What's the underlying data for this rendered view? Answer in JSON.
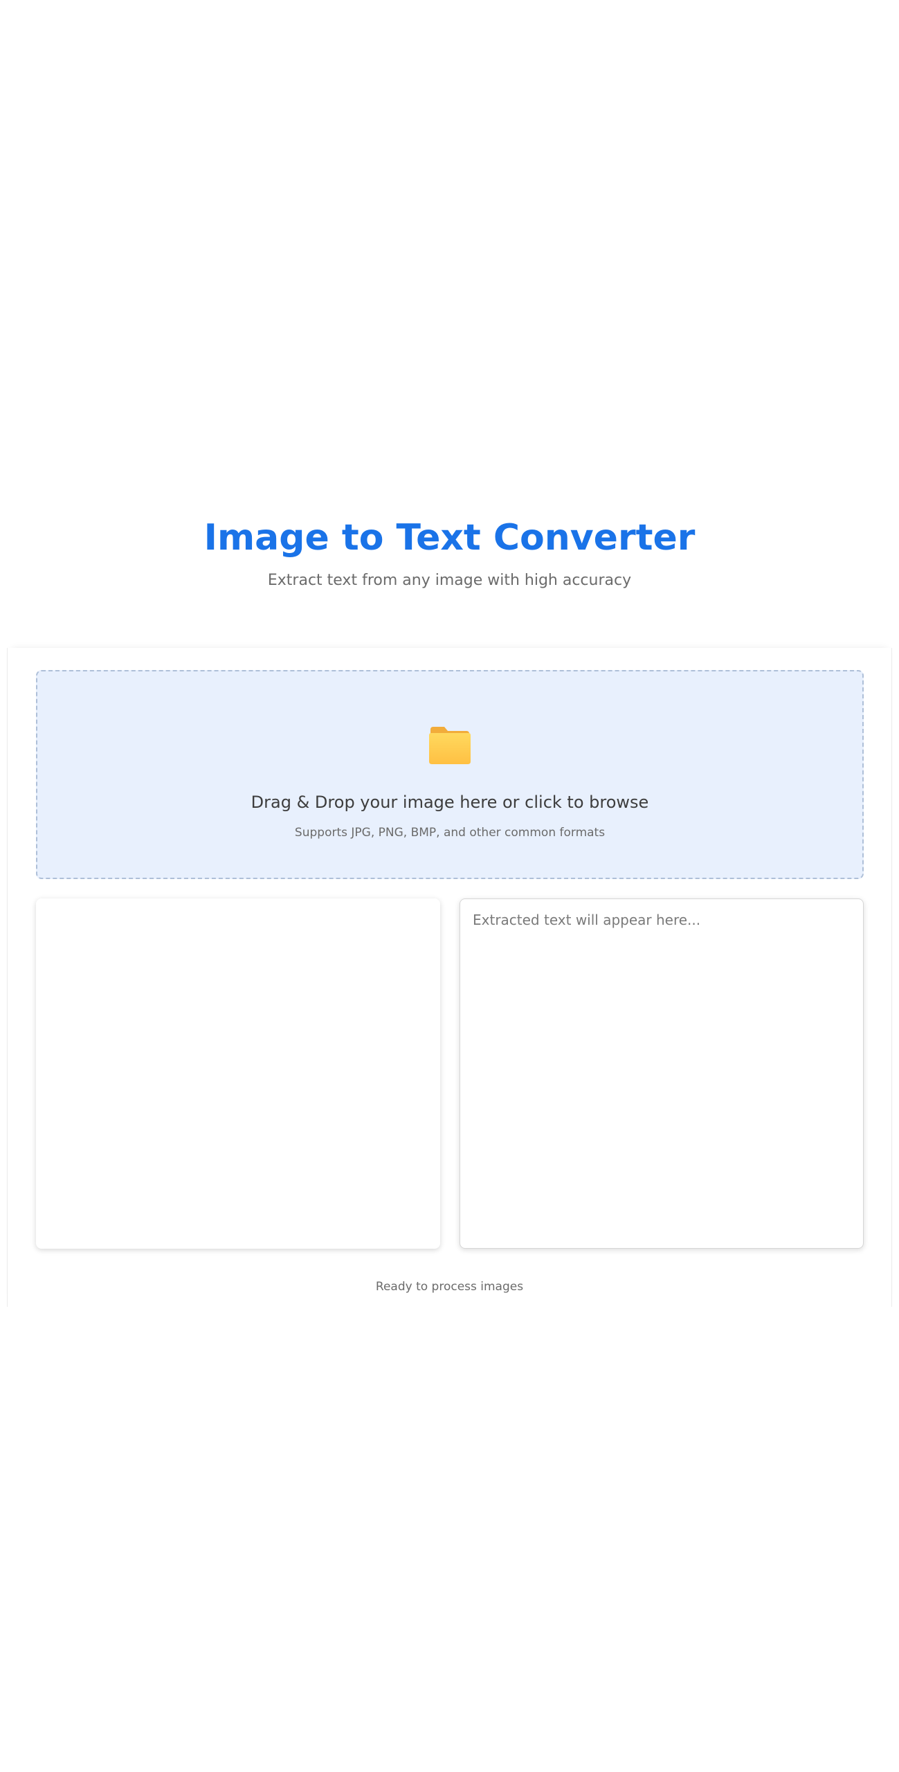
{
  "header": {
    "title": "Image to Text Converter",
    "subtitle": "Extract text from any image with high accuracy"
  },
  "dropzone": {
    "icon": "folder-icon",
    "title": "Drag & Drop your image here or click to browse",
    "formats": "Supports JPG, PNG, BMP, and other common formats"
  },
  "output": {
    "placeholder": "Extracted text will appear here...",
    "value": ""
  },
  "status": {
    "text": "Ready to process images"
  },
  "colors": {
    "accent": "#1a73e8",
    "dropzone_bg": "#e8f0fd",
    "dropzone_border": "#aebfd8",
    "folder": "#ffc94a"
  }
}
